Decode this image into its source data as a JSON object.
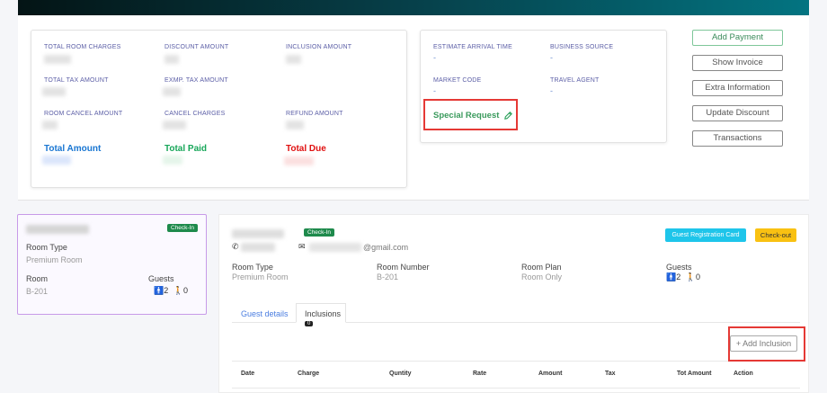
{
  "summary": {
    "labels": [
      "Total Room Charges",
      "Discount Amount",
      "Inclusion Amount",
      "Total Tax Amount",
      "Exmp. Tax Amount",
      "Room Cancel Amount",
      "Cancel Charges",
      "Refund Amount"
    ],
    "total_amount": "Total Amount",
    "total_paid": "Total Paid",
    "total_due": "Total Due",
    "colors": {
      "total_amount": "#1976d2",
      "total_paid": "#17a659",
      "total_due": "#e01010"
    }
  },
  "info": {
    "estimate_arrival_time": {
      "label": "Estimate Arrival Time",
      "value": "-"
    },
    "business_source": {
      "label": "Business Source",
      "value": "-"
    },
    "market_code": {
      "label": "Market Code",
      "value": "-"
    },
    "travel_agent": {
      "label": "Travel Agent",
      "value": "-"
    },
    "special_request": "Special Request"
  },
  "actions": [
    "Add Payment",
    "Show Invoice",
    "Extra Information",
    "Update Discount",
    "Transactions"
  ],
  "room_card": {
    "status": "Check-In",
    "room_type_label": "Room Type",
    "room_type": "Premium Room",
    "room_label": "Room",
    "room": "B-201",
    "guests_label": "Guests",
    "adults": "2",
    "children": "0"
  },
  "detail": {
    "status": "Check-In",
    "email_suffix": "@gmail.com",
    "guest_reg_card": "Guest Registration Card",
    "checkout": "Check-out",
    "room_type_label": "Room Type",
    "room_type": "Premium Room",
    "room_number_label": "Room Number",
    "room_number": "B-201",
    "room_plan_label": "Room Plan",
    "room_plan": "Room Only",
    "guests_label": "Guests",
    "adults": "2",
    "children": "0",
    "tabs": [
      {
        "label": "Guest details"
      },
      {
        "label": "Inclusions",
        "count": "0"
      }
    ],
    "add_inclusion": "+ Add Inclusion",
    "columns": [
      "Date",
      "Charge",
      "Quntity",
      "Rate",
      "Amount",
      "Tax",
      "Tot Amount",
      "Action"
    ]
  }
}
